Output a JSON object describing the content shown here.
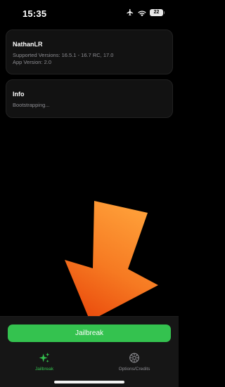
{
  "status_bar": {
    "time": "15:35",
    "battery": "22",
    "icons": [
      "airplane-icon",
      "wifi-icon",
      "battery-icon"
    ]
  },
  "device_card": {
    "title": "NathanLR",
    "supported_versions": "Supported Versions: 16.5.1 - 16.7 RC, 17.0",
    "app_version": "App Version: 2.0"
  },
  "info_card": {
    "title": "Info",
    "status": "Bootstrapping..."
  },
  "action": {
    "button_label": "Jailbreak"
  },
  "tabs": [
    {
      "label": "Jailbreak",
      "icon": "sparkles-icon",
      "selected": true
    },
    {
      "label": "Options/Credits",
      "icon": "gear-icon",
      "selected": false
    }
  ],
  "colors": {
    "accent": "#34c24f",
    "background": "#000000",
    "card": "#121212",
    "arrow_top": "#ffa13a",
    "arrow_bottom": "#ee4a0c"
  }
}
